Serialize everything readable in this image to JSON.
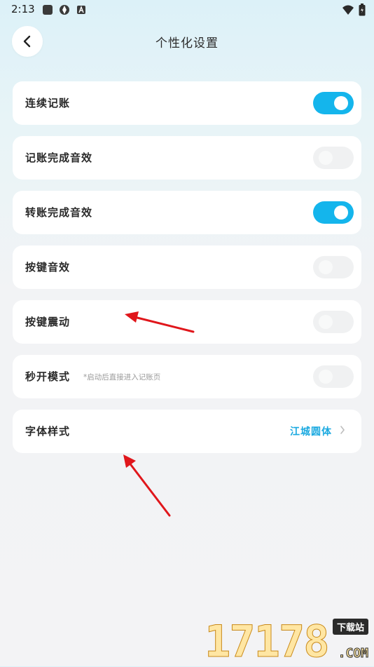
{
  "status_bar": {
    "time": "2:13"
  },
  "header": {
    "title": "个性化设置"
  },
  "settings": [
    {
      "label": "连续记账",
      "hint": "",
      "toggle": true
    },
    {
      "label": "记账完成音效",
      "hint": "",
      "toggle": false
    },
    {
      "label": "转账完成音效",
      "hint": "",
      "toggle": true
    },
    {
      "label": "按键音效",
      "hint": "",
      "toggle": false
    },
    {
      "label": "按键震动",
      "hint": "",
      "toggle": false
    },
    {
      "label": "秒开模式",
      "hint": "*启动后直接进入记账页",
      "toggle": false
    }
  ],
  "font_style": {
    "label": "字体样式",
    "value": "江城圆体"
  },
  "colors": {
    "accent": "#14b5ec",
    "annotation_arrow": "#e0161b"
  },
  "watermark": {
    "digits": "17178",
    "tag": "下载站",
    "suffix": ".COM"
  }
}
